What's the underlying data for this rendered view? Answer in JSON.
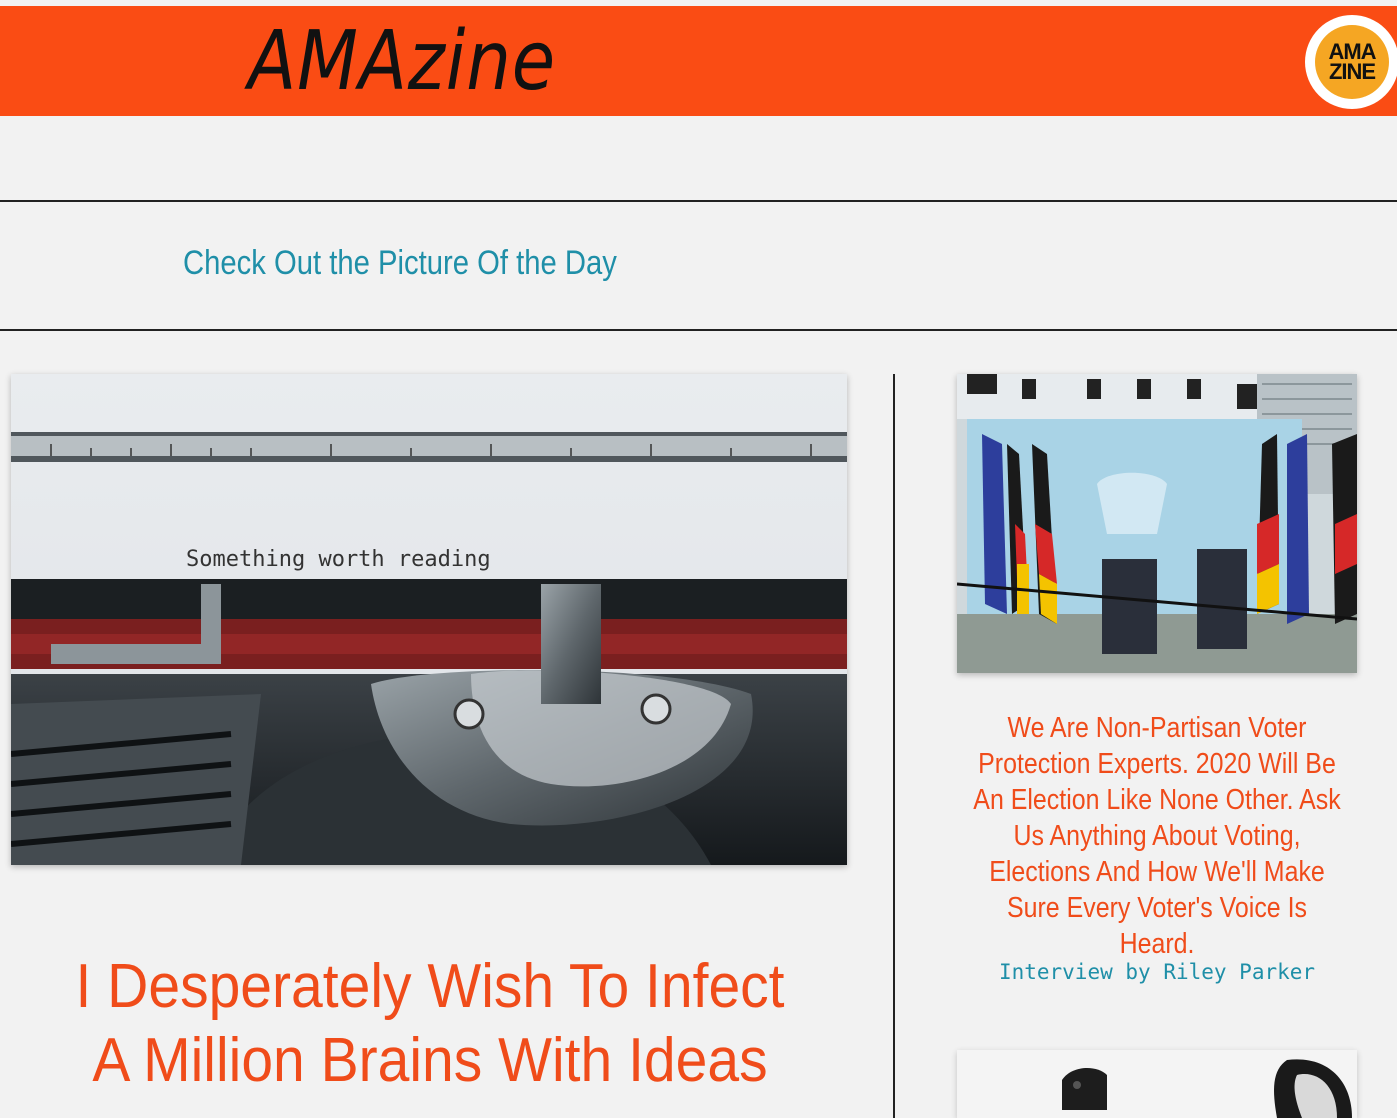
{
  "header": {
    "site_title": "AMAzine",
    "logo_text": [
      "AMA",
      "ZINE"
    ],
    "colors": {
      "brand": "#fa4c14",
      "logo": "#f5a623"
    }
  },
  "picture_of_day": {
    "link_text": "Check Out the Picture Of the Day"
  },
  "main_article": {
    "image_caption_text": "Something worth reading",
    "headline": "I Desperately Wish To Infect A Million Brains With Ideas"
  },
  "side_article": {
    "headline": "We Are Non-Partisan Voter Protection Experts. 2020 Will Be An Election Like None Other. Ask Us Anything About Voting, Elections And How We'll Make Sure Every Voter's Voice Is Heard.",
    "byline": "Interview by Riley Parker"
  },
  "colors": {
    "headline": "#f04c1a",
    "link": "#1f8fa8"
  }
}
